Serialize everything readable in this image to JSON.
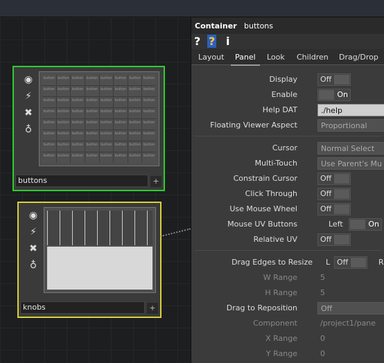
{
  "network": {
    "node1": {
      "name": "buttons",
      "cell_label": "button"
    },
    "node2": {
      "name": "knobs"
    },
    "node_tools": [
      "viewer-icon",
      "wire-icon",
      "bypass-x-icon",
      "lock-icon"
    ]
  },
  "panel": {
    "op_type": "Container",
    "op_name": "buttons",
    "help_icon": "?",
    "info_icon": "i",
    "tabs": [
      "Layout",
      "Panel",
      "Look",
      "Children",
      "Drag/Drop"
    ],
    "active_tab": "Panel",
    "params": {
      "display": {
        "label": "Display",
        "value": "Off"
      },
      "enable": {
        "label": "Enable",
        "value": "On"
      },
      "help_dat": {
        "label": "Help DAT",
        "value": "./help"
      },
      "floating_viewer": {
        "label": "Floating Viewer Aspect",
        "value": "Proportional"
      },
      "cursor": {
        "label": "Cursor",
        "value": "Normal Select"
      },
      "multi_touch": {
        "label": "Multi-Touch",
        "value": "Use Parent's Mu"
      },
      "constrain_cursor": {
        "label": "Constrain Cursor",
        "value": "Off"
      },
      "click_through": {
        "label": "Click Through",
        "value": "Off"
      },
      "mouse_wheel": {
        "label": "Use Mouse Wheel",
        "value": "Off"
      },
      "mouse_uv": {
        "label": "Mouse UV Buttons",
        "left": "Left",
        "value": "On"
      },
      "relative_uv": {
        "label": "Relative UV",
        "value": "Off"
      },
      "drag_edges": {
        "label": "Drag Edges to Resize",
        "l": "L",
        "value": "Off",
        "r": "R"
      },
      "w_range": {
        "label": "W Range",
        "value": "5"
      },
      "h_range": {
        "label": "H Range",
        "value": "5"
      },
      "drag_repos": {
        "label": "Drag to Reposition",
        "value": "Off"
      },
      "component": {
        "label": "Component",
        "value": "/project1/pane"
      },
      "x_range": {
        "label": "X Range",
        "value": "0"
      },
      "y_range": {
        "label": "Y Range",
        "value": "0"
      }
    }
  }
}
